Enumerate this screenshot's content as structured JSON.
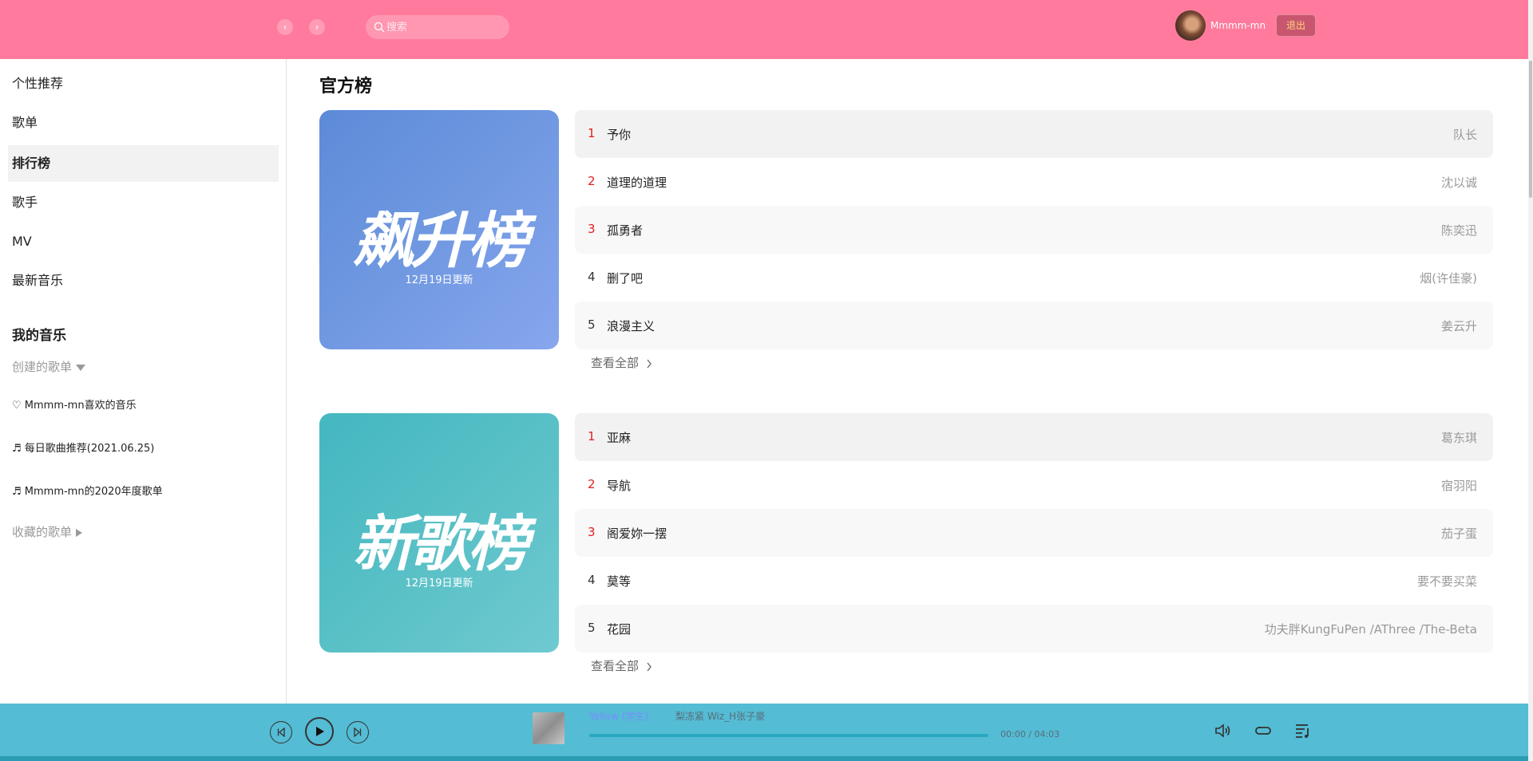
{
  "header": {
    "nav_back": "‹",
    "nav_forward": "›",
    "search_placeholder": "搜索",
    "username": "Mmmm-mn",
    "logout": "退出"
  },
  "sidebar": {
    "items": [
      {
        "label": "个性推荐",
        "active": false
      },
      {
        "label": "歌单",
        "active": false
      },
      {
        "label": "排行榜",
        "active": true
      },
      {
        "label": "歌手",
        "active": false
      },
      {
        "label": "MV",
        "active": false
      },
      {
        "label": "最新音乐",
        "active": false
      }
    ],
    "my_music_title": "我的音乐",
    "created_playlists_label": "创建的歌单",
    "playlists": [
      "♡ Mmmm-mn喜欢的音乐",
      "♬ 每日歌曲推荐(2021.06.25)",
      "♬ Mmmm-mn的2020年度歌单"
    ],
    "collected_playlists_label": "收藏的歌单"
  },
  "main": {
    "title": "官方榜",
    "charts": [
      {
        "cover_title": "飙升榜",
        "update_text": "12月19日更新",
        "see_all": "查看全部",
        "tracks": [
          {
            "rank": "1",
            "name": "予你",
            "artist": "队长"
          },
          {
            "rank": "2",
            "name": "道理的道理",
            "artist": "沈以诚"
          },
          {
            "rank": "3",
            "name": "孤勇者",
            "artist": "陈奕迅"
          },
          {
            "rank": "4",
            "name": "删了吧",
            "artist": "烟(许佳豪)"
          },
          {
            "rank": "5",
            "name": "浪漫主义",
            "artist": "姜云升"
          }
        ]
      },
      {
        "cover_title": "新歌榜",
        "update_text": "12月19日更新",
        "see_all": "查看全部",
        "tracks": [
          {
            "rank": "1",
            "name": "亚麻",
            "artist": "葛东琪"
          },
          {
            "rank": "2",
            "name": "导航",
            "artist": "宿羽阳"
          },
          {
            "rank": "3",
            "name": "阁爱妳一摆",
            "artist": "茄子蛋"
          },
          {
            "rank": "4",
            "name": "莫等",
            "artist": "要不要买菜"
          },
          {
            "rank": "5",
            "name": "花园",
            "artist": "功夫胖KungFuPen /AThree /The-Beta"
          }
        ]
      }
    ]
  },
  "player": {
    "song_title": "Yellow (学生)",
    "artists": "梨冻紧   Wiz_H张子豪",
    "time": "00:00 / 04:03",
    "progress": 0
  },
  "colors": {
    "header_bg": "#ff7a9c",
    "player_bg": "#54bcd4",
    "rank_top": "#e02020"
  }
}
